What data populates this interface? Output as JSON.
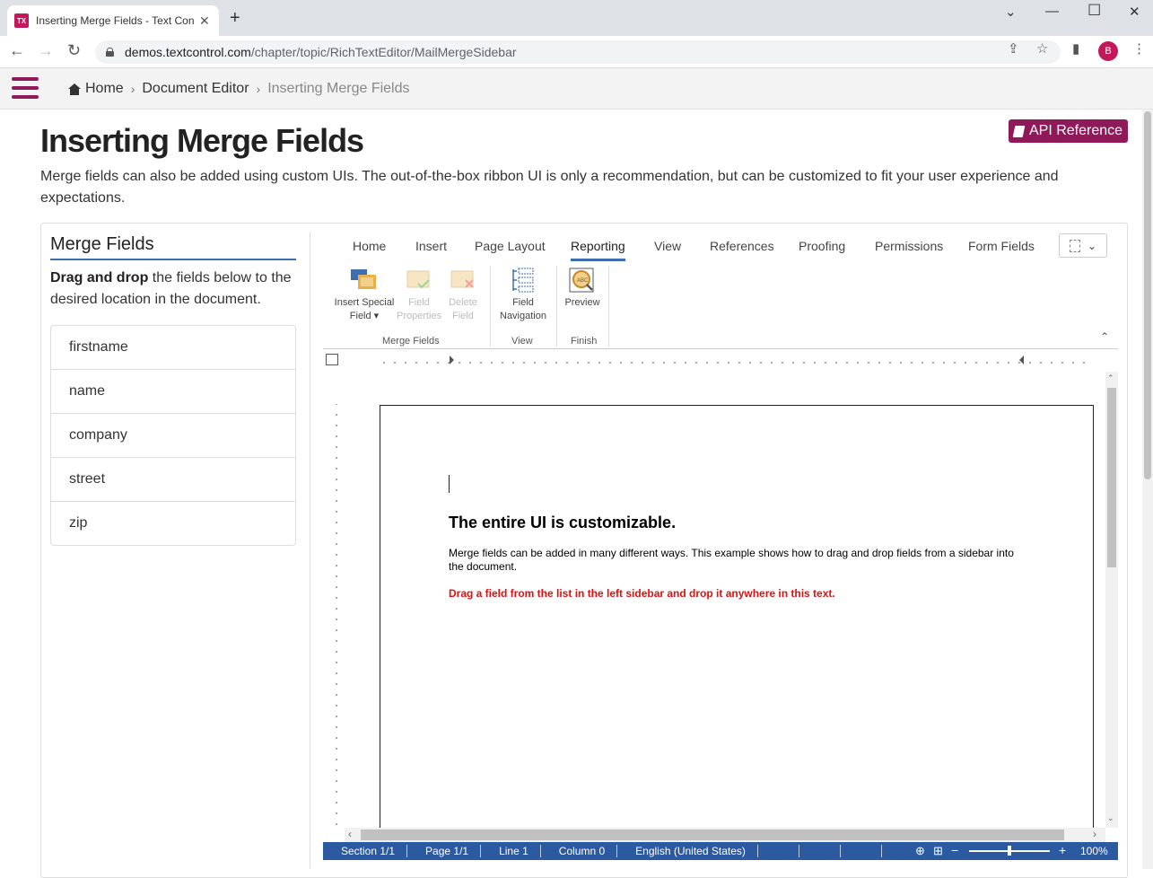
{
  "browser": {
    "tab_title": "Inserting Merge Fields - Text Con",
    "url_host": "demos.textcontrol.com",
    "url_path": "/chapter/topic/RichTextEditor/MailMergeSidebar",
    "avatar_letter": "B",
    "favicon_text": "TX"
  },
  "header": {
    "breadcrumb": [
      "Home",
      "Document Editor",
      "Inserting Merge Fields"
    ]
  },
  "page": {
    "title": "Inserting Merge Fields",
    "api_button": "API Reference",
    "intro": "Merge fields can also be added using custom UIs. The out-of-the-box ribbon UI is only a recommendation, but can be customized to fit your user experience and expectations."
  },
  "sidebar": {
    "title": "Merge Fields",
    "desc_bold": "Drag and drop",
    "desc_rest": " the fields below to the desired location in the document.",
    "fields": [
      "firstname",
      "name",
      "company",
      "street",
      "zip"
    ]
  },
  "ribbon": {
    "tabs": [
      "Home",
      "Insert",
      "Page Layout",
      "Reporting",
      "View",
      "References",
      "Proofing",
      "Permissions",
      "Form Fields"
    ],
    "active_tab": "Reporting",
    "buttons": {
      "insert_special_1": "Insert Special",
      "insert_special_2": "Field ▾",
      "field_properties_1": "Field",
      "field_properties_2": "Properties",
      "delete_field_1": "Delete",
      "delete_field_2": "Field",
      "field_navigation_1": "Field",
      "field_navigation_2": "Navigation",
      "preview": "Preview"
    },
    "groups": [
      "Merge Fields",
      "View",
      "Finish"
    ]
  },
  "document": {
    "heading": "The entire UI is customizable.",
    "paragraph": "Merge fields can be added in many different ways. This example shows how to drag and drop fields from a sidebar into the document.",
    "red_text": "Drag a field from the list in the left sidebar and drop it anywhere in this text."
  },
  "statusbar": {
    "section": "Section 1/1",
    "page": "Page 1/1",
    "line": "Line 1",
    "column": "Column 0",
    "language": "English (United States)",
    "zoom": "100%",
    "zoom_minus": "−",
    "zoom_plus": "+"
  },
  "colors": {
    "brand": "#8e1a5a",
    "accent": "#3d6fb0",
    "statusbar": "#2c5aa0",
    "doc_red": "#e01010"
  }
}
